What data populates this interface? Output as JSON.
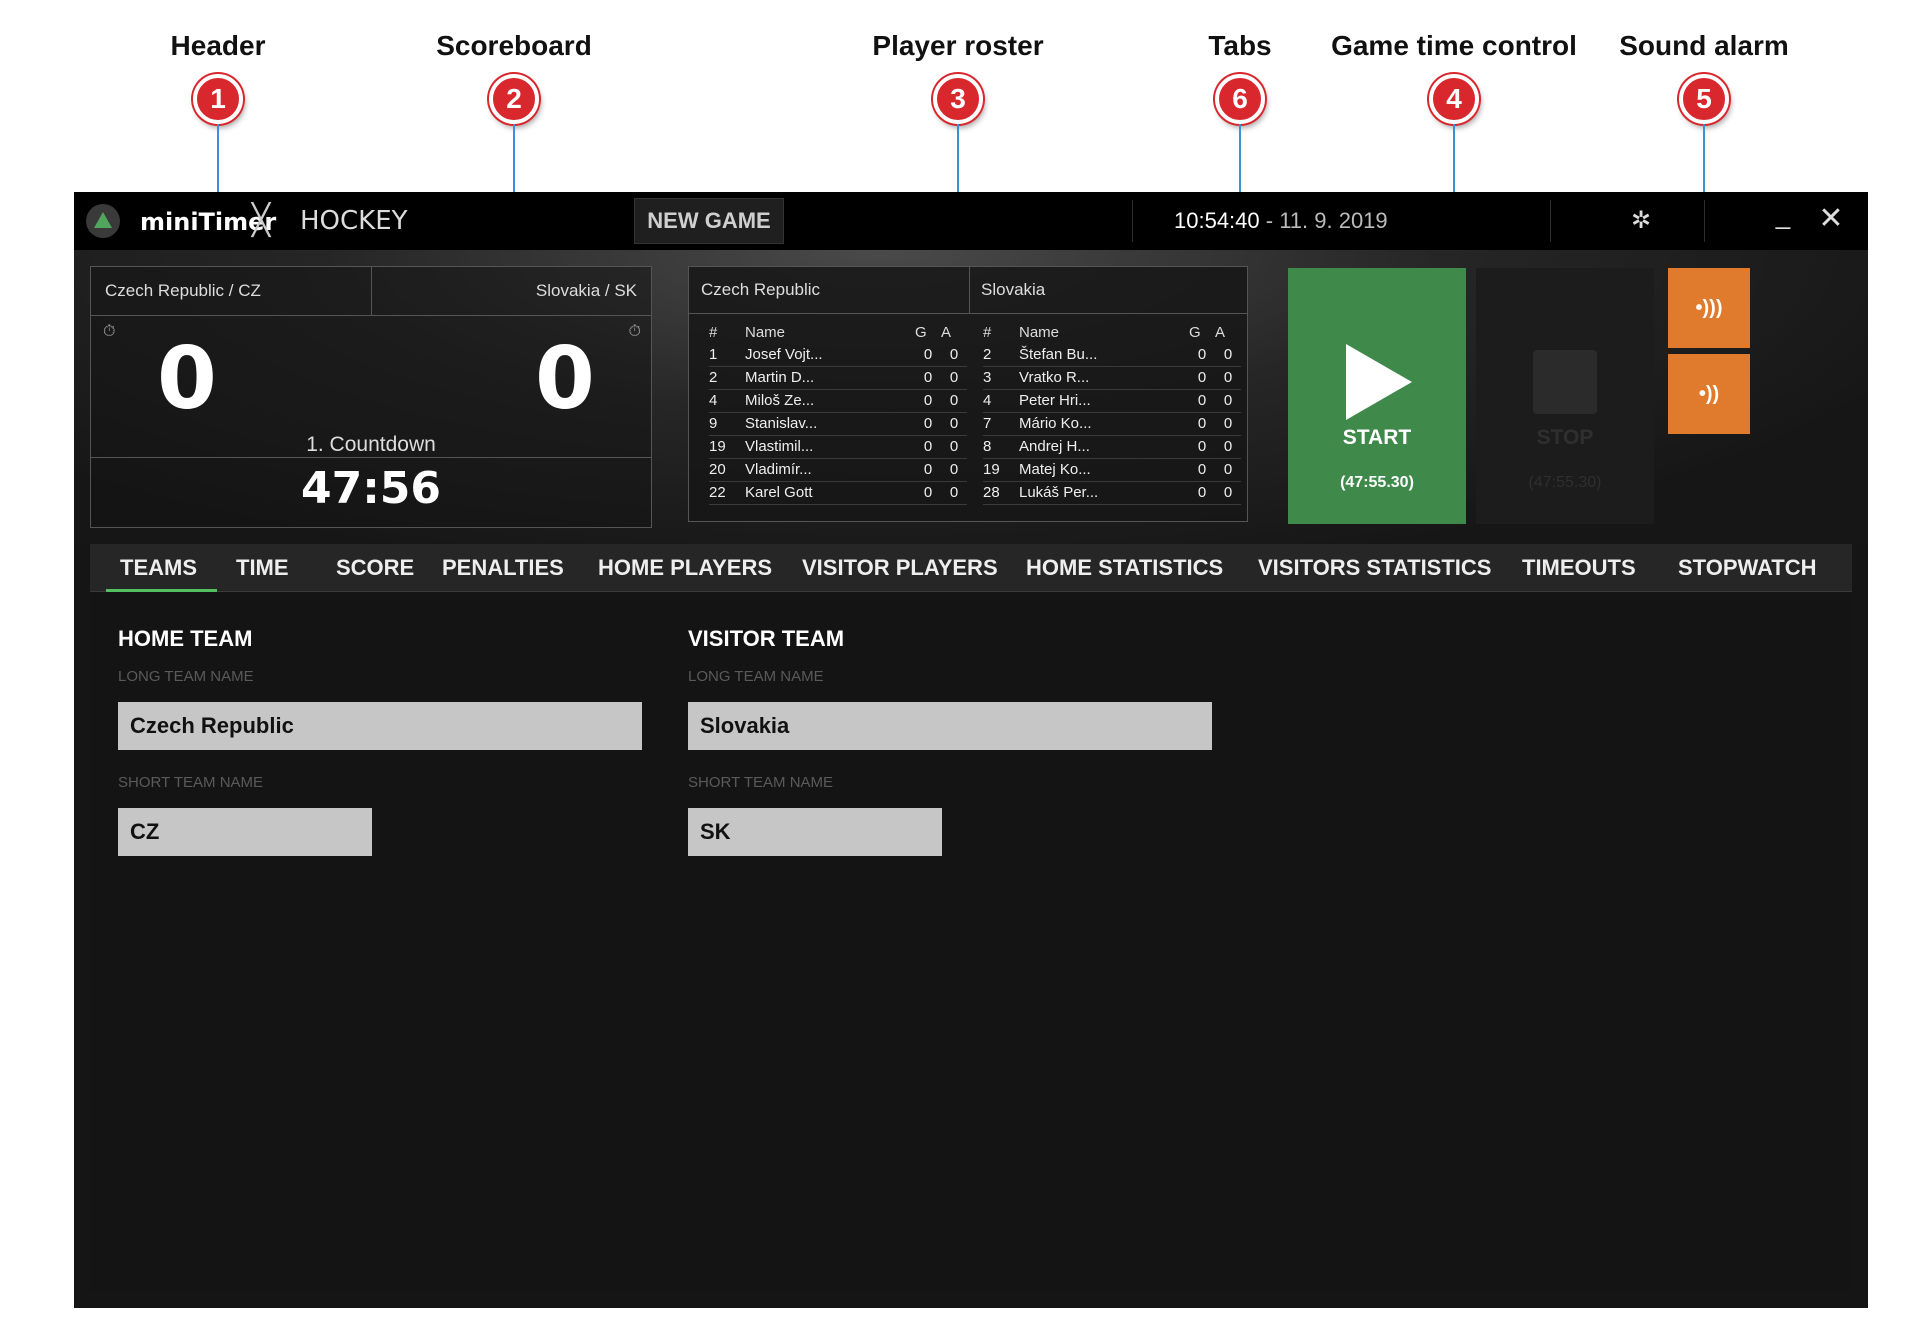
{
  "callouts": [
    {
      "num": "1",
      "label": "Header"
    },
    {
      "num": "2",
      "label": "Scoreboard"
    },
    {
      "num": "3",
      "label": "Player roster"
    },
    {
      "num": "6",
      "label": "Tabs"
    },
    {
      "num": "4",
      "label": "Game time control"
    },
    {
      "num": "5",
      "label": "Sound alarm"
    }
  ],
  "header": {
    "app_name": "miniTimer",
    "sport": "HOCKEY",
    "new_game_label": "NEW GAME",
    "time": "10:54:40",
    "date": " - 11. 9. 2019",
    "icons": [
      "logo-icon",
      "hockey-sticks-icon",
      "gear-icon",
      "minimize-icon",
      "close-icon"
    ]
  },
  "scoreboard": {
    "home_label": "Czech Republic / CZ",
    "visitor_label": "Slovakia / SK",
    "home_score": "0",
    "visitor_score": "0",
    "period": "1. Countdown",
    "time": "47:56"
  },
  "roster": {
    "home_team": "Czech Republic",
    "visitor_team": "Slovakia",
    "columns": [
      "#",
      "Name",
      "G",
      "A"
    ],
    "home": [
      [
        "1",
        "Josef Vojt...",
        "0",
        "0"
      ],
      [
        "2",
        "Martin D...",
        "0",
        "0"
      ],
      [
        "4",
        "Miloš Ze...",
        "0",
        "0"
      ],
      [
        "9",
        "Stanislav...",
        "0",
        "0"
      ],
      [
        "19",
        "Vlastimil...",
        "0",
        "0"
      ],
      [
        "20",
        "Vladimír...",
        "0",
        "0"
      ],
      [
        "22",
        "Karel Gott",
        "0",
        "0"
      ]
    ],
    "visitor": [
      [
        "2",
        "Štefan Bu...",
        "0",
        "0"
      ],
      [
        "3",
        "Vratko R...",
        "0",
        "0"
      ],
      [
        "4",
        "Peter Hri...",
        "0",
        "0"
      ],
      [
        "7",
        "Mário Ko...",
        "0",
        "0"
      ],
      [
        "8",
        "Andrej H...",
        "0",
        "0"
      ],
      [
        "19",
        "Matej Ko...",
        "0",
        "0"
      ],
      [
        "28",
        "Lukáš Per...",
        "0",
        "0"
      ]
    ]
  },
  "controls": {
    "start_label": "START",
    "start_time": "(47:55.30)",
    "stop_label": "STOP",
    "stop_time": "(47:55.30)",
    "alarm_long_icon": "•)))",
    "alarm_short_icon": "•))"
  },
  "tabs": [
    "TEAMS",
    "TIME",
    "SCORE",
    "PENALTIES",
    "HOME PLAYERS",
    "VISITOR PLAYERS",
    "HOME STATISTICS",
    "VISITORS STATISTICS",
    "TIMEOUTS",
    "STOPWATCH"
  ],
  "active_tab": "TEAMS",
  "teams_form": {
    "home_title": "HOME TEAM",
    "visitor_title": "VISITOR TEAM",
    "long_name_label": "LONG TEAM NAME",
    "short_name_label": "SHORT TEAM NAME",
    "home_long": "Czech Republic",
    "home_short": "CZ",
    "visitor_long": "Slovakia",
    "visitor_short": "SK"
  },
  "colors": {
    "start_green": "#3f8a4b",
    "alarm_orange": "#e07b2e",
    "badge_red": "#d9272e",
    "tab_underline": "#52c05f",
    "leader_blue": "#3a8fd6"
  }
}
